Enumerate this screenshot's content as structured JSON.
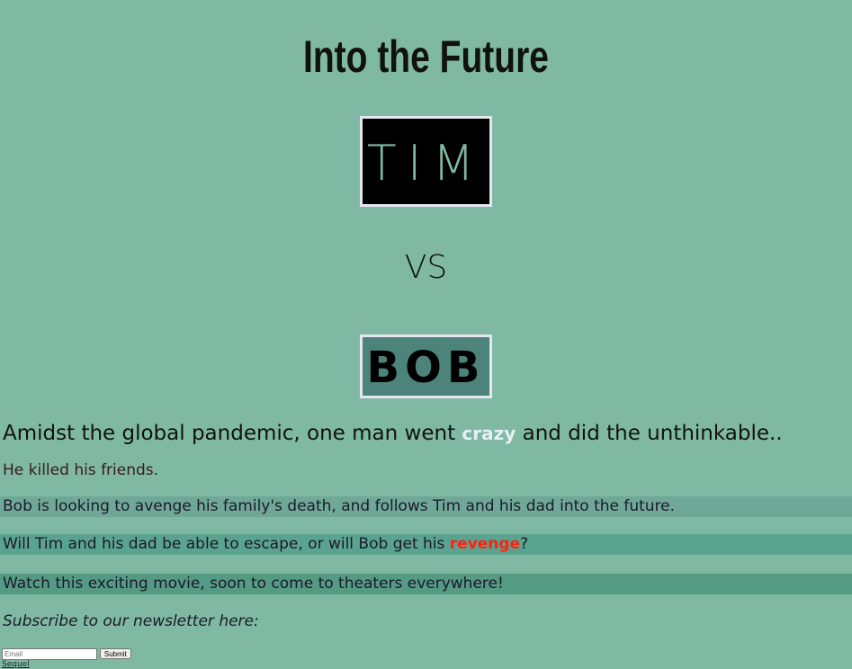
{
  "title": "Into the Future",
  "logos": {
    "tim": "TIM",
    "bob": "BOB"
  },
  "vs": "VS",
  "lead": {
    "before": "Amidst the global pandemic, one man went ",
    "crazy": "crazy",
    "after": " and did the unthinkable.."
  },
  "p1": "He killed his friends.",
  "p2": "Bob is looking to avenge his family's death, and follows Tim and his dad into the future.",
  "p3": {
    "before": "Will Tim and his dad be able to escape, or will Bob get his ",
    "revenge": "revenge",
    "after": "?"
  },
  "p4": "Watch this exciting movie, soon to come to theaters everywhere!",
  "subscribe": "Subscribe to our newsletter here:",
  "form": {
    "email_placeholder": "Email",
    "submit": "Submit"
  },
  "link": "Sequel"
}
